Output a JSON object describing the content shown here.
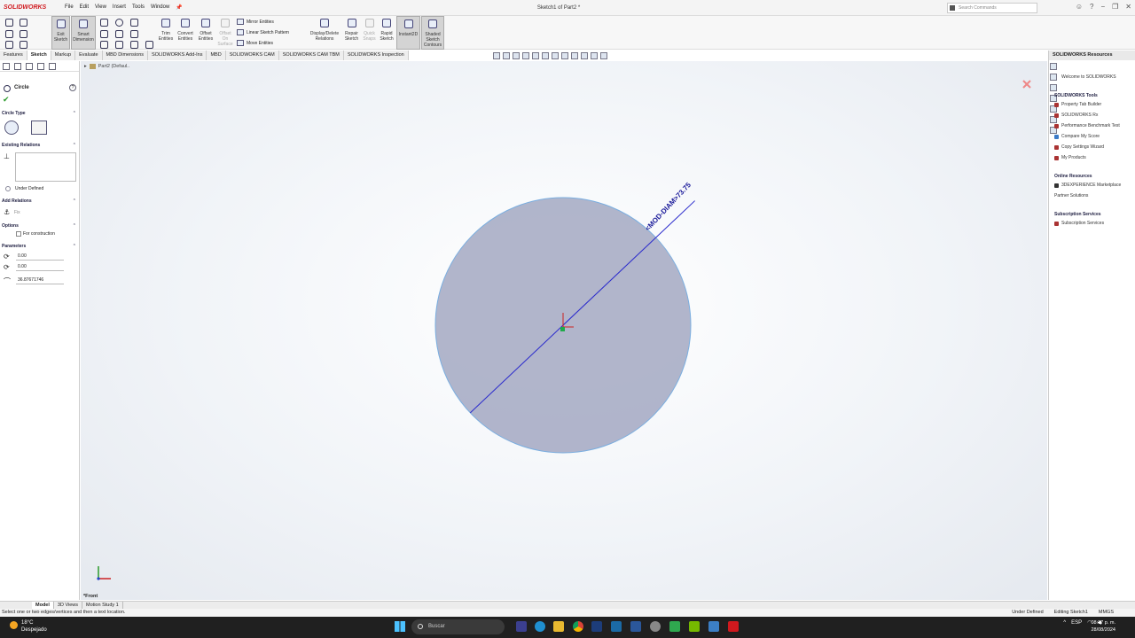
{
  "app": {
    "logo": "SOLIDWORKS",
    "document_title": "Sketch1 of Part2 *",
    "search_placeholder": "Search Commands",
    "menus": [
      "File",
      "Edit",
      "View",
      "Insert",
      "Tools",
      "Window"
    ]
  },
  "ribbon": {
    "exit_sketch": "Exit\nSketch",
    "smart_dimension": "Smart\nDimension",
    "trim": "Trim\nEntities",
    "convert": "Convert\nEntities",
    "offset": "Offset\nEntities",
    "offset_surface": "Offset\nOn\nSurface",
    "mirror": "Mirror Entities",
    "linear_pattern": "Linear Sketch Pattern",
    "move": "Move Entities",
    "display_delete": "Display/Delete\nRelations",
    "repair": "Repair\nSketch",
    "quick_snaps": "Quick\nSnaps",
    "rapid_sketch": "Rapid\nSketch",
    "instant2d": "Instant2D",
    "shaded_contours": "Shaded\nSketch\nContours"
  },
  "command_tabs": [
    "Features",
    "Sketch",
    "Markup",
    "Evaluate",
    "MBD Dimensions",
    "SOLIDWORKS Add-Ins",
    "MBD",
    "SOLIDWORKS CAM",
    "SOLIDWORKS CAM TBM",
    "SOLIDWORKS Inspection"
  ],
  "active_command_tab": "Sketch",
  "property_manager": {
    "title": "Circle",
    "circle_type": "Circle Type",
    "existing_relations": "Existing Relations",
    "status": "Under Defined",
    "add_relations": "Add Relations",
    "fix": "Fix",
    "options": "Options",
    "for_construction": "For construction",
    "parameters": "Parameters",
    "x": "0.00",
    "y": "0.00",
    "radius": "36.87671746"
  },
  "viewport": {
    "tree_item": "Part2 (Defaul..",
    "dimension_label": "<MOD-DIAM>73.75",
    "view_name": "*Front"
  },
  "task_pane": {
    "header": "SOLIDWORKS Resources",
    "welcome": "Welcome to SOLIDWORKS",
    "tools_title": "SOLIDWORKS Tools",
    "tools": [
      "Property Tab Builder",
      "SOLIDWORKS Rx",
      "Performance Benchmark Test",
      "Compare My Score",
      "Copy Settings Wizard",
      "My Products"
    ],
    "online_title": "Online Resources",
    "online": [
      "3DEXPERIENCE Marketplace",
      "Partner Solutions"
    ],
    "subscription_title": "Subscription Services",
    "subscription": [
      "Subscription Services"
    ]
  },
  "bottom_tabs": [
    "Model",
    "3D Views",
    "Motion Study 1"
  ],
  "status_bar": {
    "message": "Select one or two edges/vertices and then a text location.",
    "defined": "Under Defined",
    "editing": "Editing Sketch1",
    "units": "MMGS"
  },
  "taskbar": {
    "temperature": "18°C",
    "weather": "Despejado",
    "search": "Buscar",
    "language": "ESP",
    "time": "08:17 p. m.",
    "date": "28/08/2024"
  },
  "colors": {
    "circle_fill": "#a3a8c2",
    "circle_edge": "#7aaee0",
    "diameter_line": "#2a2acc",
    "brand_red": "#d0191e"
  }
}
